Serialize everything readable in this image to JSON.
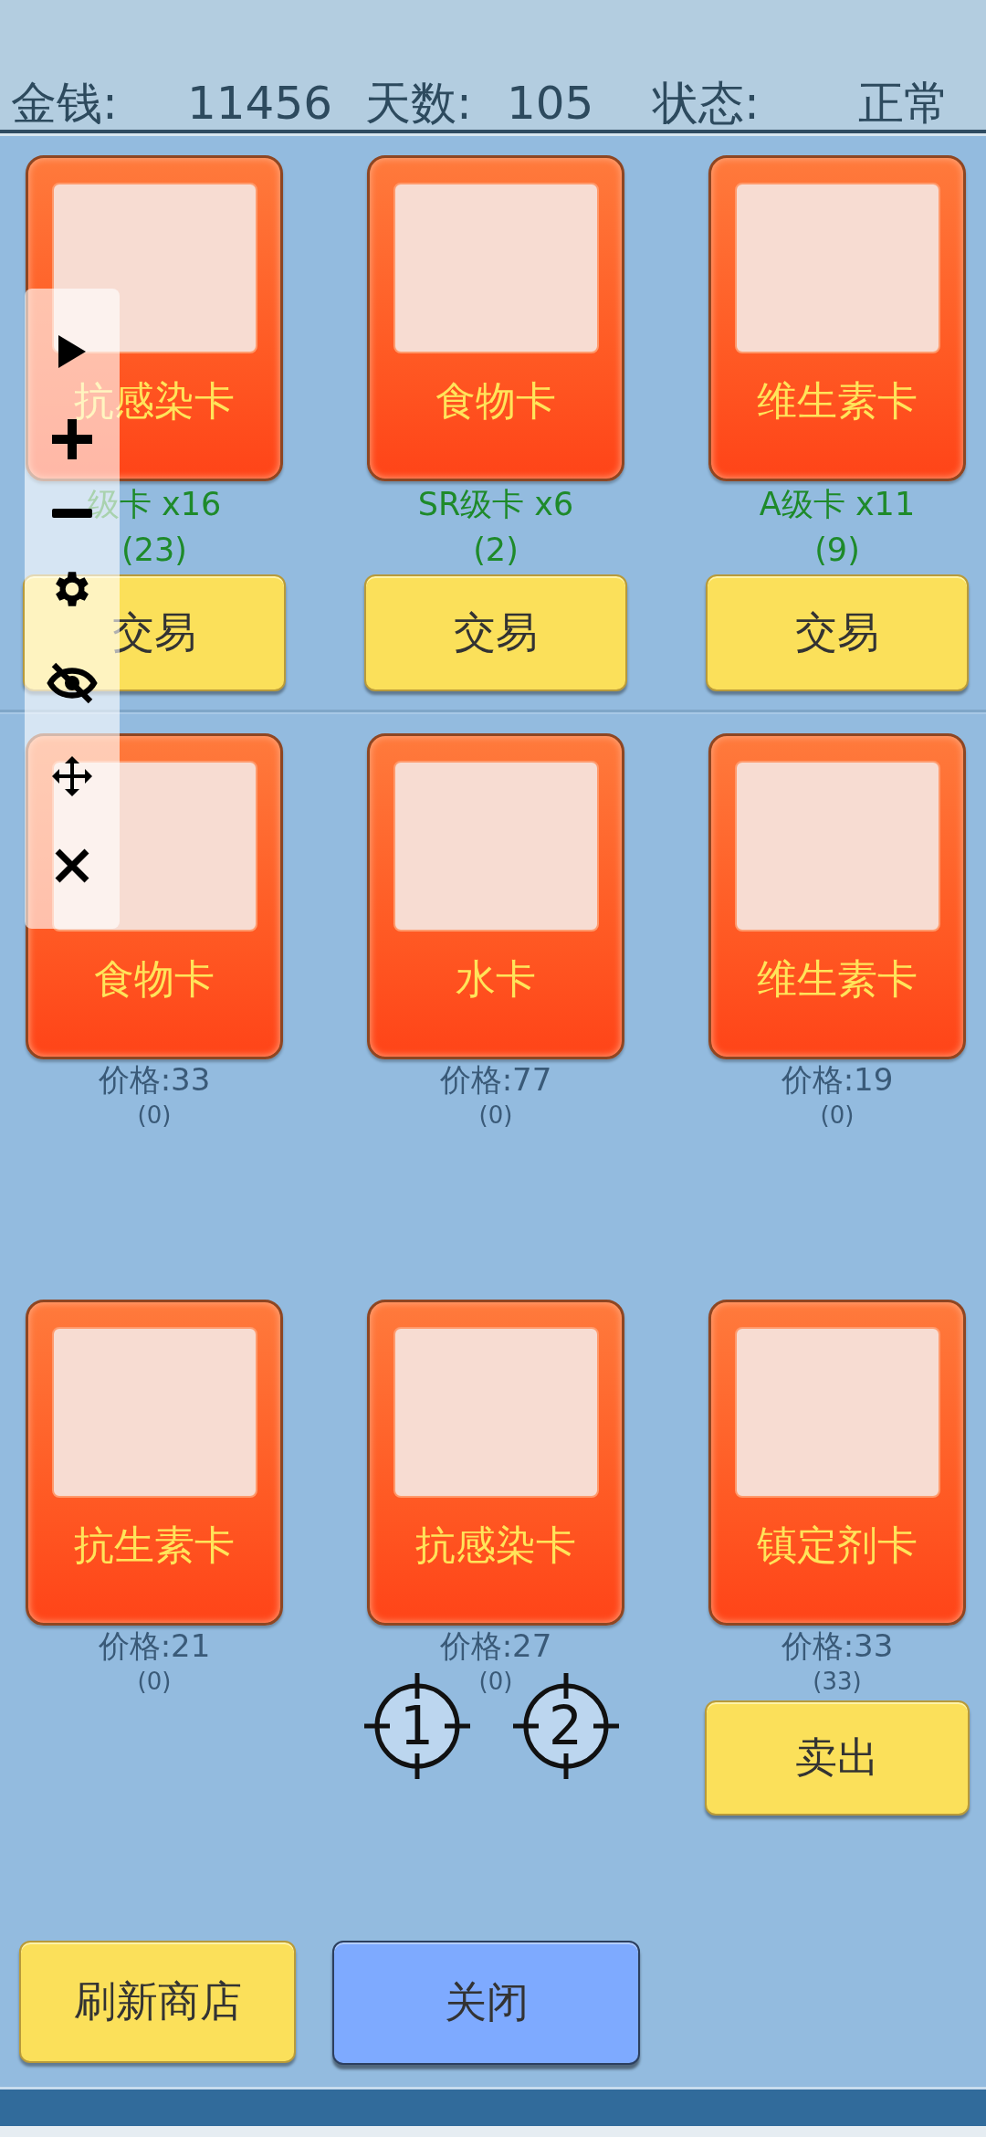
{
  "header": {
    "money_label": "金钱:",
    "money": "11456",
    "days_label": "天数:",
    "days": "105",
    "status_label": "状态:",
    "status": "正常"
  },
  "owned_cards": [
    {
      "name": "抗感染卡",
      "grade": "级卡 x16",
      "count": "(23)",
      "button": "交易"
    },
    {
      "name": "食物卡",
      "grade": "SR级卡 x6",
      "count": "(2)",
      "button": "交易"
    },
    {
      "name": "维生素卡",
      "grade": "A级卡 x11",
      "count": "(9)",
      "button": "交易"
    }
  ],
  "shop_cards": [
    {
      "name": "食物卡",
      "price": "价格:33",
      "count": "(0)"
    },
    {
      "name": "水卡",
      "price": "价格:77",
      "count": "(0)"
    },
    {
      "name": "维生素卡",
      "price": "价格:19",
      "count": "(0)"
    },
    {
      "name": "抗生素卡",
      "price": "价格:21",
      "count": "(0)"
    },
    {
      "name": "抗感染卡",
      "price": "价格:27",
      "count": "(0)",
      "markers": [
        "1",
        "2"
      ]
    },
    {
      "name": "镇定剂卡",
      "price": "价格:33",
      "count": "(33)",
      "button": "卖出"
    }
  ],
  "footer_buttons": [
    {
      "label": "刷新商店",
      "kind": "refresh"
    },
    {
      "label": "关闭",
      "kind": "close"
    }
  ]
}
